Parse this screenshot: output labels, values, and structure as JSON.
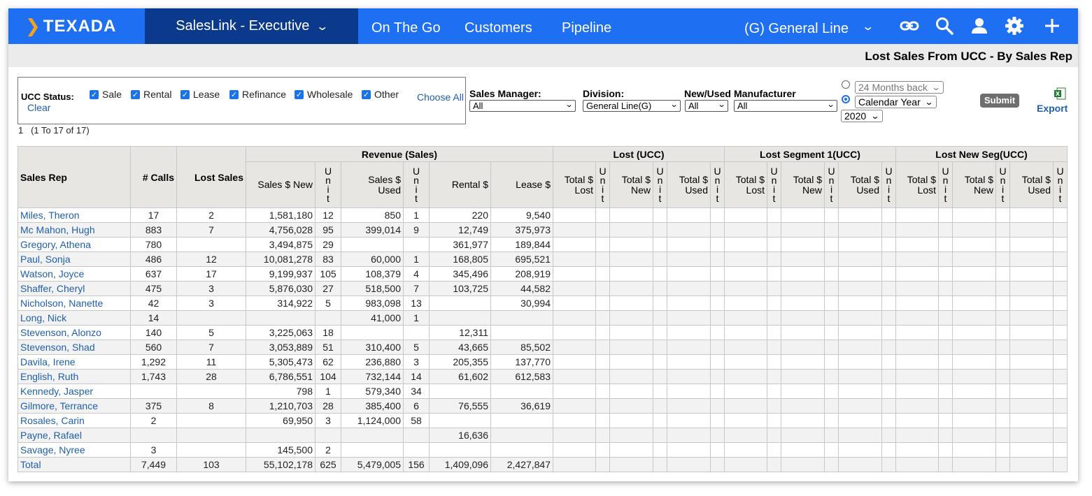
{
  "nav": {
    "logo": "TEXADA",
    "app_switcher": "SalesLink - Executive",
    "links": [
      "On The Go",
      "Customers",
      "Pipeline"
    ],
    "line_selector": "(G) General Line",
    "brand_color": "#1e6ff1",
    "icons": [
      "link-icon",
      "search-icon",
      "user-icon",
      "settings-icon",
      "add-icon"
    ]
  },
  "report": {
    "title": "Lost Sales From UCC - By Sales Rep"
  },
  "filters": {
    "ucc_status_label": "UCC Status:",
    "statuses": [
      "Sale",
      "Rental",
      "Lease",
      "Refinance",
      "Wholesale",
      "Other"
    ],
    "choose_all": "Choose All",
    "clear": "Clear",
    "sales_manager": {
      "label": "Sales Manager:",
      "value": "All"
    },
    "division": {
      "label": "Division:",
      "value": "General Line(G)"
    },
    "new_used": {
      "label": "New/Used",
      "value": "All"
    },
    "manufacturer": {
      "label": "Manufacturer",
      "value": "All"
    },
    "period_option_1": "24 Months back",
    "period_option_2": "Calendar Year",
    "year": "2020",
    "submit": "Submit",
    "export": "Export"
  },
  "paging": {
    "page": "1",
    "range": "(1 To 17 of 17)"
  },
  "table": {
    "headers": {
      "sales_rep": "Sales Rep",
      "calls": "# Calls",
      "lost_sales": "Lost Sales",
      "revenue_group": "Revenue (Sales)",
      "lost_group": "Lost (UCC)",
      "seg1_group": "Lost Segment 1(UCC)",
      "newseg_group": "Lost New Seg(UCC)",
      "sales_new": "Sales $ New",
      "unit": "Unit",
      "sales_used": "Sales $ Used",
      "rental": "Rental $",
      "lease": "Lease $",
      "total_lost": "Total $ Lost",
      "total_new": "Total $ New",
      "total_used": "Total $ Used"
    },
    "rows": [
      {
        "rep": "Miles, Theron",
        "calls": "17",
        "lost": "2",
        "sales_new": "1,581,180",
        "u1": "12",
        "sales_used": "850",
        "u2": "1",
        "rental": "220",
        "lease": "9,540"
      },
      {
        "rep": "Mc Mahon, Hugh",
        "calls": "883",
        "lost": "7",
        "sales_new": "4,756,028",
        "u1": "95",
        "sales_used": "399,014",
        "u2": "9",
        "rental": "12,749",
        "lease": "375,973"
      },
      {
        "rep": "Gregory, Athena",
        "calls": "780",
        "lost": "",
        "sales_new": "3,494,875",
        "u1": "29",
        "sales_used": "",
        "u2": "",
        "rental": "361,977",
        "lease": "189,844"
      },
      {
        "rep": "Paul, Sonja",
        "calls": "486",
        "lost": "12",
        "sales_new": "10,081,278",
        "u1": "83",
        "sales_used": "60,000",
        "u2": "1",
        "rental": "168,805",
        "lease": "695,521"
      },
      {
        "rep": "Watson, Joyce",
        "calls": "637",
        "lost": "17",
        "sales_new": "9,199,937",
        "u1": "105",
        "sales_used": "108,379",
        "u2": "4",
        "rental": "345,496",
        "lease": "208,919"
      },
      {
        "rep": "Shaffer, Cheryl",
        "calls": "475",
        "lost": "3",
        "sales_new": "5,876,030",
        "u1": "27",
        "sales_used": "518,500",
        "u2": "7",
        "rental": "103,725",
        "lease": "44,582"
      },
      {
        "rep": "Nicholson, Nanette",
        "calls": "42",
        "lost": "3",
        "sales_new": "314,922",
        "u1": "5",
        "sales_used": "983,098",
        "u2": "13",
        "rental": "",
        "lease": "30,994"
      },
      {
        "rep": "Long, Nick",
        "calls": "14",
        "lost": "",
        "sales_new": "",
        "u1": "",
        "sales_used": "41,000",
        "u2": "1",
        "rental": "",
        "lease": ""
      },
      {
        "rep": "Stevenson, Alonzo",
        "calls": "140",
        "lost": "5",
        "sales_new": "3,225,063",
        "u1": "18",
        "sales_used": "",
        "u2": "",
        "rental": "12,311",
        "lease": ""
      },
      {
        "rep": "Stevenson, Shad",
        "calls": "560",
        "lost": "7",
        "sales_new": "3,053,889",
        "u1": "51",
        "sales_used": "310,400",
        "u2": "5",
        "rental": "43,665",
        "lease": "85,502"
      },
      {
        "rep": "Davila, Irene",
        "calls": "1,292",
        "lost": "11",
        "sales_new": "5,305,473",
        "u1": "62",
        "sales_used": "236,880",
        "u2": "3",
        "rental": "205,355",
        "lease": "137,770"
      },
      {
        "rep": "English, Ruth",
        "calls": "1,743",
        "lost": "28",
        "sales_new": "6,786,551",
        "u1": "104",
        "sales_used": "732,144",
        "u2": "14",
        "rental": "61,602",
        "lease": "612,583"
      },
      {
        "rep": "Kennedy, Jasper",
        "calls": "",
        "lost": "",
        "sales_new": "798",
        "u1": "1",
        "sales_used": "579,340",
        "u2": "34",
        "rental": "",
        "lease": ""
      },
      {
        "rep": "Gilmore, Terrance",
        "calls": "375",
        "lost": "8",
        "sales_new": "1,210,703",
        "u1": "28",
        "sales_used": "385,400",
        "u2": "6",
        "rental": "76,555",
        "lease": "36,619"
      },
      {
        "rep": "Rosales, Carin",
        "calls": "2",
        "lost": "",
        "sales_new": "69,950",
        "u1": "3",
        "sales_used": "1,124,000",
        "u2": "58",
        "rental": "",
        "lease": ""
      },
      {
        "rep": "Payne, Rafael",
        "calls": "",
        "lost": "",
        "sales_new": "",
        "u1": "",
        "sales_used": "",
        "u2": "",
        "rental": "16,636",
        "lease": ""
      },
      {
        "rep": "Savage, Nyree",
        "calls": "3",
        "lost": "",
        "sales_new": "145,500",
        "u1": "2",
        "sales_used": "",
        "u2": "",
        "rental": "",
        "lease": ""
      },
      {
        "rep": "Total",
        "calls": "7,449",
        "lost": "103",
        "sales_new": "55,102,178",
        "u1": "625",
        "sales_used": "5,479,005",
        "u2": "156",
        "rental": "1,409,096",
        "lease": "2,427,847"
      }
    ]
  }
}
